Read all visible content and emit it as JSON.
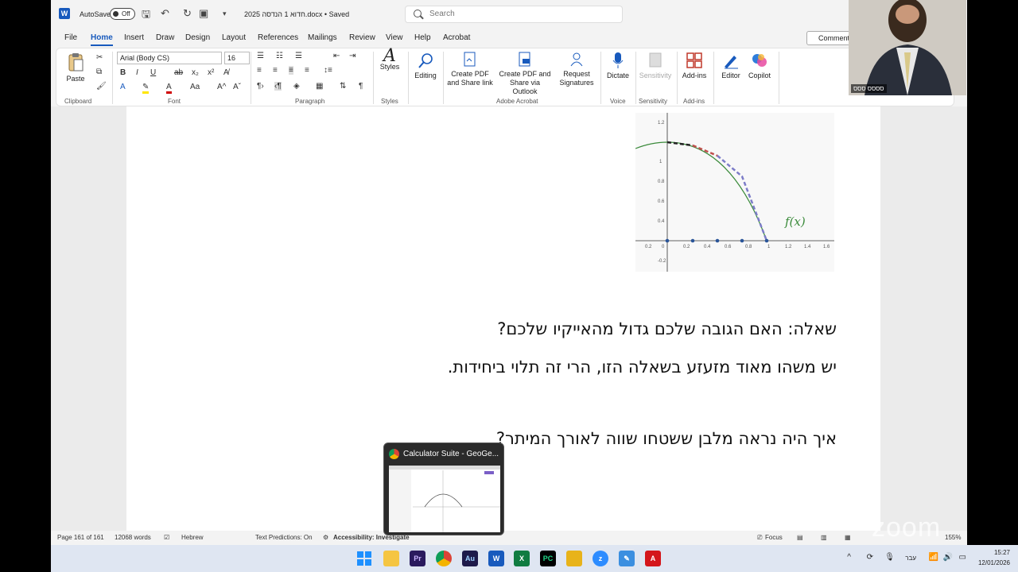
{
  "window": {
    "autosave_label": "AutoSave",
    "autosave_state": "Off",
    "doc_title": "2025 חדוא 1 הנדסה.docx • Saved",
    "search_placeholder": "Search"
  },
  "menu": {
    "tabs": [
      "File",
      "Home",
      "Insert",
      "Draw",
      "Design",
      "Layout",
      "References",
      "Mailings",
      "Review",
      "View",
      "Help",
      "Acrobat"
    ],
    "active": "Home",
    "comments": "Comments"
  },
  "ribbon": {
    "clipboard": {
      "paste": "Paste",
      "label": "Clipboard"
    },
    "font": {
      "name": "Arial (Body CS)",
      "size": "16",
      "label": "Font"
    },
    "paragraph": {
      "label": "Paragraph"
    },
    "styles": {
      "button": "Styles",
      "label": "Styles"
    },
    "editing": {
      "button": "Editing"
    },
    "acrobat": {
      "create_pdf_share_link": [
        "Create PDF",
        "and Share link"
      ],
      "create_pdf_outlook": [
        "Create PDF and",
        "Share via Outlook"
      ],
      "request_signatures": [
        "Request",
        "Signatures"
      ],
      "label": "Adobe Acrobat"
    },
    "voice": {
      "button": "Dictate",
      "label": "Voice"
    },
    "sensitivity": {
      "button": "Sensitivity",
      "label": "Sensitivity"
    },
    "addins": {
      "button": "Add-ins",
      "label": "Add-ins"
    },
    "editor": "Editor",
    "copilot": "Copilot"
  },
  "document": {
    "graph_label": "f(x)",
    "graph_x_ticks": [
      "0.2",
      "0",
      "0.2",
      "0.4",
      "0.6",
      "0.8",
      "1",
      "1.2",
      "1.4",
      "1.6"
    ],
    "graph_y_ticks": [
      "1.2",
      "1",
      "0.8",
      "0.6",
      "0.4",
      "0.2",
      "-0.2"
    ],
    "line1": "שאלה: האם הגובה שלכם גדול מהאייקיו שלכם?",
    "line2": "יש משהו מאוד מזעזע בשאלה הזו, הרי זה תלוי ביחידות.",
    "line3": "איך היה נראה מלבן ששטחו שווה לאורך המיתר?"
  },
  "status": {
    "page": "Page 161 of 161",
    "words": "12068 words",
    "language": "Hebrew",
    "text_predictions": "Text Predictions: On",
    "accessibility": "Accessibility: Investigate",
    "focus": "Focus",
    "zoom": "155%"
  },
  "camera": {
    "name": "סססס ססס"
  },
  "preview": {
    "title": "Calculator Suite - GeoGe..."
  },
  "taskbar": {
    "apps": [
      "windows",
      "file-explorer",
      "premiere",
      "chrome",
      "audition",
      "word",
      "excel",
      "pycharm",
      "files",
      "zoom",
      "draw",
      "acrobat"
    ],
    "lang": "עבר",
    "time": "15:27",
    "date": "12/01/2026"
  },
  "watermark": "zoom",
  "colors": {
    "word_blue": "#185abd",
    "taskbar": "#dfe6f2",
    "curve_green": "#3a8a3a"
  }
}
